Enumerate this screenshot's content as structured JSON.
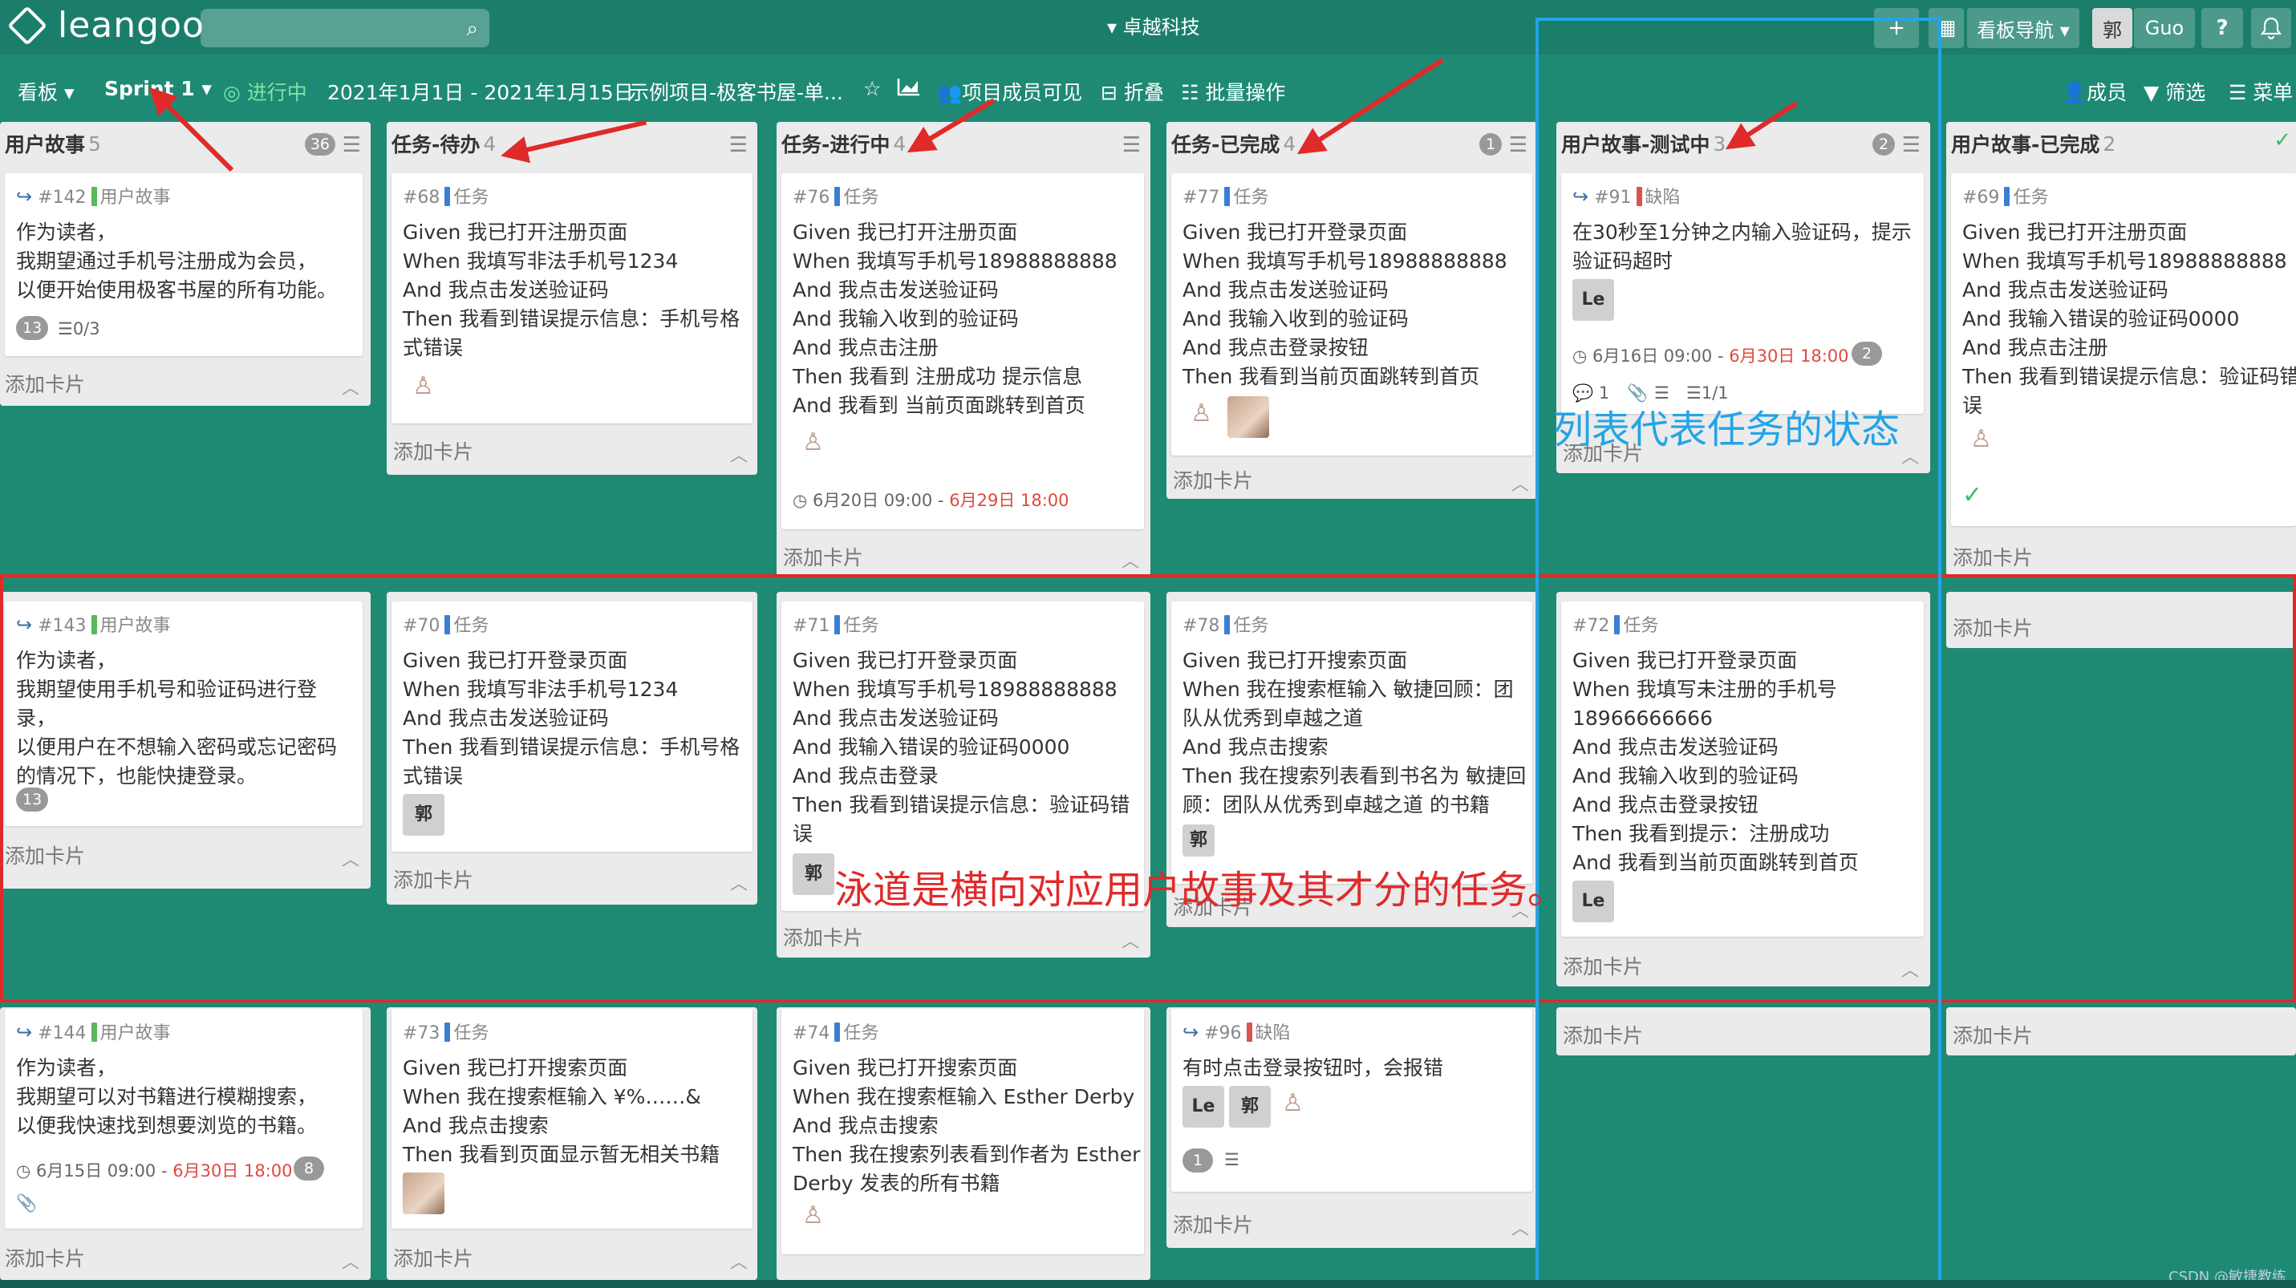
{
  "topbar": {
    "logo_text": "leangoo",
    "org_name": "▾ 卓越科技",
    "plus_icon": "+",
    "grid_icon": "▦",
    "board_nav_label": "看板导航 ▾",
    "user_avatar": "郭",
    "user_name": "Guo",
    "help_label": "?",
    "bell_icon": "bell-icon"
  },
  "subbar": {
    "board_label": "看板 ▾",
    "sprint_label": "Sprint 1 ▾",
    "status_label": "◎ 进行中",
    "date_range": "2021年1月1日 - 2021年1月15日",
    "project_label": "示例项目-极客书屋-单...",
    "star_icon": "☆",
    "chart_icon": "chart-icon",
    "visibility_label": "项目成员可见",
    "fold_label": "折叠",
    "batch_label": "批量操作",
    "members_label": "成员",
    "filter_label": "筛选",
    "menu_label": "菜单"
  },
  "common": {
    "add_card": "添加卡片",
    "collapse": "︿",
    "menu_icon": "☰",
    "link_icon": "↪"
  },
  "columns": [
    {
      "title": "用户故事",
      "count": "5",
      "badge": "36"
    },
    {
      "title": "任务-待办",
      "count": "4"
    },
    {
      "title": "任务-进行中",
      "count": "4"
    },
    {
      "title": "任务-已完成",
      "count": "4",
      "badge": "1"
    },
    {
      "title": "用户故事-测试中",
      "count": "3",
      "badge": "2"
    },
    {
      "title": "用户故事-已完成",
      "count": "2"
    }
  ],
  "colors": {
    "story": "#5cb85c",
    "task": "#3a7fd5",
    "bug": "#d9534f",
    "annotation_red": "#e02a2a",
    "annotation_blue": "#23a4e6",
    "board_bg": "#1e8a74"
  },
  "cards": {
    "c142": {
      "id": "#142",
      "type": "用户故事",
      "lines": [
        "作为读者，",
        "我期望通过手机号注册成为会员，",
        "以便开始使用极客书屋的所有功能。"
      ],
      "chip": "13",
      "checklist": "☰0/3"
    },
    "c68": {
      "id": "#68",
      "type": "任务",
      "lines": [
        "Given 我已打开注册页面",
        "When 我填写非法手机号1234",
        "And 我点击发送验证码",
        "Then 我看到错误提示信息：手机号格",
        "式错误"
      ]
    },
    "c76": {
      "id": "#76",
      "type": "任务",
      "lines": [
        "Given 我已打开注册页面",
        "When 我填写手机号18988888888",
        "And 我点击发送验证码",
        "And 我输入收到的验证码",
        "And 我点击注册",
        "Then 我看到 注册成功 提示信息",
        "And 我看到 当前页面跳转到首页"
      ],
      "date": "6月20日 09:00 - ",
      "due": "6月29日 18:00"
    },
    "c77": {
      "id": "#77",
      "type": "任务",
      "lines": [
        "Given 我已打开登录页面",
        "When 我填写手机号18988888888",
        "And 我点击发送验证码",
        "And 我输入收到的验证码",
        "And 我点击登录按钮",
        "Then 我看到当前页面跳转到首页"
      ]
    },
    "c91": {
      "id": "#91",
      "type": "缺陷",
      "lines": [
        "在30秒至1分钟之内输入验证码，提示",
        "验证码超时"
      ],
      "avatar": "Le",
      "date": "6月16日 09:00 - ",
      "due": "6月30日 18:00",
      "chip": "2",
      "comments": "1",
      "checklist": "☰1/1"
    },
    "c69": {
      "id": "#69",
      "type": "任务",
      "lines": [
        "Given 我已打开注册页面",
        "When 我填写手机号18988888888",
        "And 我点击发送验证码",
        "And 我输入错误的验证码0000",
        "And 我点击注册",
        "Then 我看到错误提示信息：验证码错",
        "误"
      ]
    },
    "c143": {
      "id": "#143",
      "type": "用户故事",
      "lines": [
        "作为读者，",
        "我期望使用手机号和验证码进行登",
        "录，",
        "以便用户在不想输入密码或忘记密码",
        "的情况下，也能快捷登录。"
      ],
      "chip": "13"
    },
    "c70": {
      "id": "#70",
      "type": "任务",
      "lines": [
        "Given 我已打开登录页面",
        "When 我填写非法手机号1234",
        "And 我点击发送验证码",
        "Then 我看到错误提示信息：手机号格",
        "式错误"
      ],
      "avatar": "郭"
    },
    "c71": {
      "id": "#71",
      "type": "任务",
      "lines": [
        "Given 我已打开登录页面",
        "When 我填写手机号18988888888",
        "And 我点击发送验证码",
        "And 我输入错误的验证码0000",
        "And 我点击登录",
        "Then 我看到错误提示信息：验证码错",
        "误"
      ],
      "avatar": "郭"
    },
    "c78": {
      "id": "#78",
      "type": "任务",
      "lines": [
        "Given 我已打开搜索页面",
        "When 我在搜索框输入 敏捷回顾：团",
        "队从优秀到卓越之道",
        "And 我点击搜索",
        "Then 我在搜索列表看到书名为 敏捷回",
        "顾：团队从优秀到卓越之道 的书籍"
      ],
      "avatar": "郭"
    },
    "c72": {
      "id": "#72",
      "type": "任务",
      "lines": [
        "Given 我已打开登录页面",
        "When 我填写未注册的手机号",
        "18966666666",
        "And 我点击发送验证码",
        "And 我输入收到的验证码",
        "And 我点击登录按钮",
        "Then 我看到提示：注册成功",
        "And 我看到当前页面跳转到首页"
      ],
      "avatar": "Le"
    },
    "c144": {
      "id": "#144",
      "type": "用户故事",
      "lines": [
        "作为读者，",
        "我期望可以对书籍进行模糊搜索，",
        "以便我快速找到想要浏览的书籍。"
      ],
      "date": "6月15日 09:00 - ",
      "due": "6月30日 18:00",
      "chip": "8"
    },
    "c73": {
      "id": "#73",
      "type": "任务",
      "lines": [
        "Given 我已打开搜索页面",
        "When 我在搜索框输入 ¥%……&",
        "And 我点击搜索",
        "Then 我看到页面显示暂无相关书籍"
      ]
    },
    "c74": {
      "id": "#74",
      "type": "任务",
      "lines": [
        "Given 我已打开搜索页面",
        "When 我在搜索框输入 Esther Derby",
        "And 我点击搜索",
        "Then 我在搜索列表看到作者为 Esther",
        "Derby 发表的所有书籍"
      ]
    },
    "c96": {
      "id": "#96",
      "type": "缺陷",
      "lines": [
        "有时点击登录按钮时，会报错"
      ],
      "avatar1": "Le",
      "avatar2": "郭",
      "chip": "1"
    }
  },
  "annotations": {
    "lane_note": "泳道是横向对应用户故事及其才分的任务。",
    "column_note": "列表代表任务的状态"
  },
  "watermark": "CSDN @敏捷教练"
}
